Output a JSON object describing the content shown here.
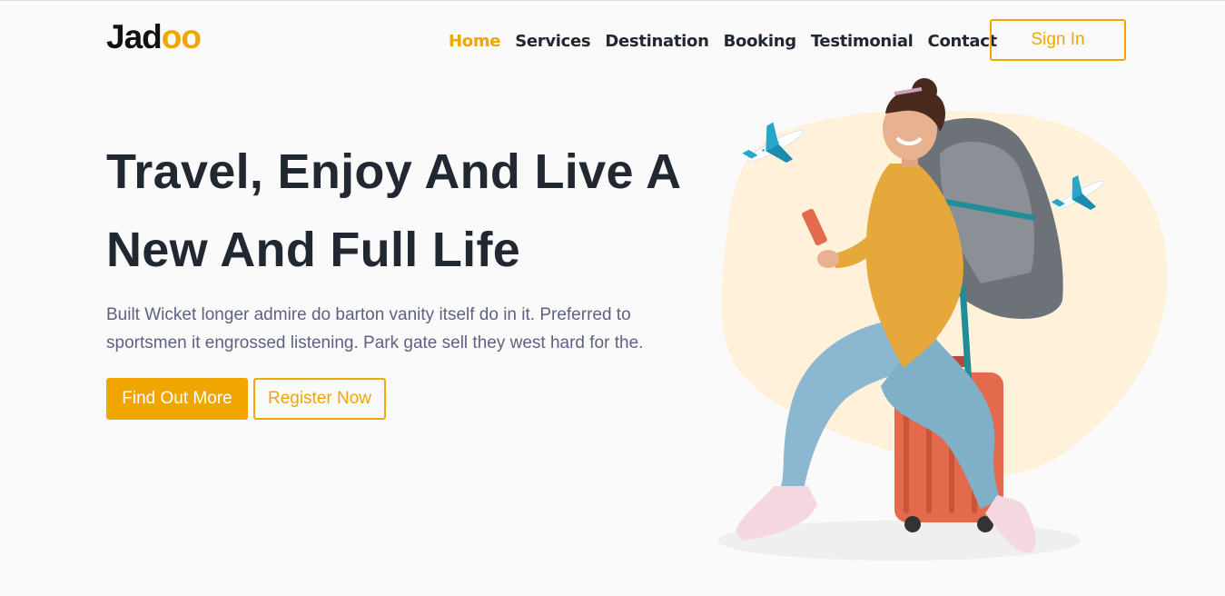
{
  "brand": {
    "logo_prefix": "Jad",
    "logo_suffix": "oo",
    "accent": "#f1a501"
  },
  "nav": {
    "items": [
      {
        "label": "Home",
        "active": true
      },
      {
        "label": "Services",
        "active": false
      },
      {
        "label": "Destination",
        "active": false
      },
      {
        "label": "Booking",
        "active": false
      },
      {
        "label": "Testimonial",
        "active": false
      },
      {
        "label": "Contact",
        "active": false
      }
    ],
    "signin_label": "Sign In"
  },
  "hero": {
    "headline_line1": "Travel, Enjoy And Live A",
    "headline_line2": "New And Full Life",
    "subtitle": "Built Wicket longer admire do barton vanity itself do in it. Preferred to sportsmen it engrossed listening. Park gate sell they west hard for the.",
    "primary_button": "Find Out More",
    "secondary_button": "Register Now"
  },
  "colors": {
    "heading": "#212832",
    "body": "#5e6282",
    "blob": "#fff1da",
    "plane": "#27a6c9",
    "suitcase": "#e36a4c"
  }
}
